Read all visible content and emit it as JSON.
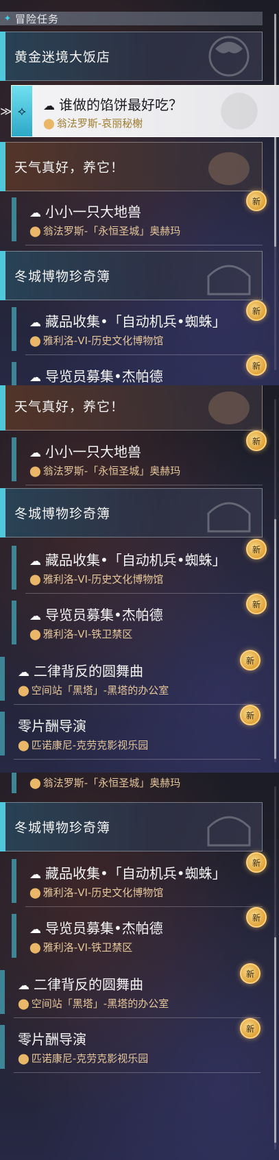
{
  "header": {
    "icon": "diamond-icon",
    "title": "冒险任务"
  },
  "badge_new": "新",
  "panel1": {
    "group_golden": "黄金迷境大饭店",
    "selected": {
      "title": "谁做的馅饼最好吃？",
      "location": "翁法罗斯-哀丽秘榭"
    },
    "group_weather": "天气真好，养它！",
    "task_small": {
      "title": "小小一只大地兽",
      "location": "翁法罗斯-「永恒圣城」奥赫玛"
    },
    "group_museum": "冬城博物珍奇簿",
    "task_collect": {
      "title": "藏品收集•「自动机兵•蜘蛛」",
      "location": "雅利洛-VI-历史文化博物馆"
    },
    "task_guide_partial": "导览员募集•杰帕德"
  },
  "panel2": {
    "group_weather": "天气真好，养它！",
    "task_small": {
      "title": "小小一只大地兽",
      "location": "翁法罗斯-「永恒圣城」奥赫玛"
    },
    "group_museum": "冬城博物珍奇簿",
    "task_collect": {
      "title": "藏品收集•「自动机兵•蜘蛛」",
      "location": "雅利洛-VI-历史文化博物馆"
    },
    "task_guide": {
      "title": "导览员募集•杰帕德",
      "location": "雅利洛-VI-铁卫禁区"
    },
    "task_rondo": {
      "title": "二律背反的圆舞曲",
      "location": "空间站「黑塔」-黑塔的办公室"
    },
    "task_director": {
      "title": "零片酬导演",
      "location": "匹诺康尼-克劳克影视乐园"
    }
  },
  "panel3": {
    "partial_location": "翁法罗斯-「永恒圣城」奥赫玛",
    "group_museum": "冬城博物珍奇簿",
    "task_collect": {
      "title": "藏品收集•「自动机兵•蜘蛛」",
      "location": "雅利洛-VI-历史文化博物馆"
    },
    "task_guide": {
      "title": "导览员募集•杰帕德",
      "location": "雅利洛-VI-铁卫禁区"
    },
    "task_rondo": {
      "title": "二律背反的圆舞曲",
      "location": "空间站「黑塔」-黑塔的办公室"
    },
    "task_director": {
      "title": "零片酬导演",
      "location": "匹诺康尼-克劳克影视乐园"
    }
  },
  "colors": {
    "accent": "#4fc8dc",
    "location_text": "#e6c79a",
    "badge": "#e0a33a"
  }
}
